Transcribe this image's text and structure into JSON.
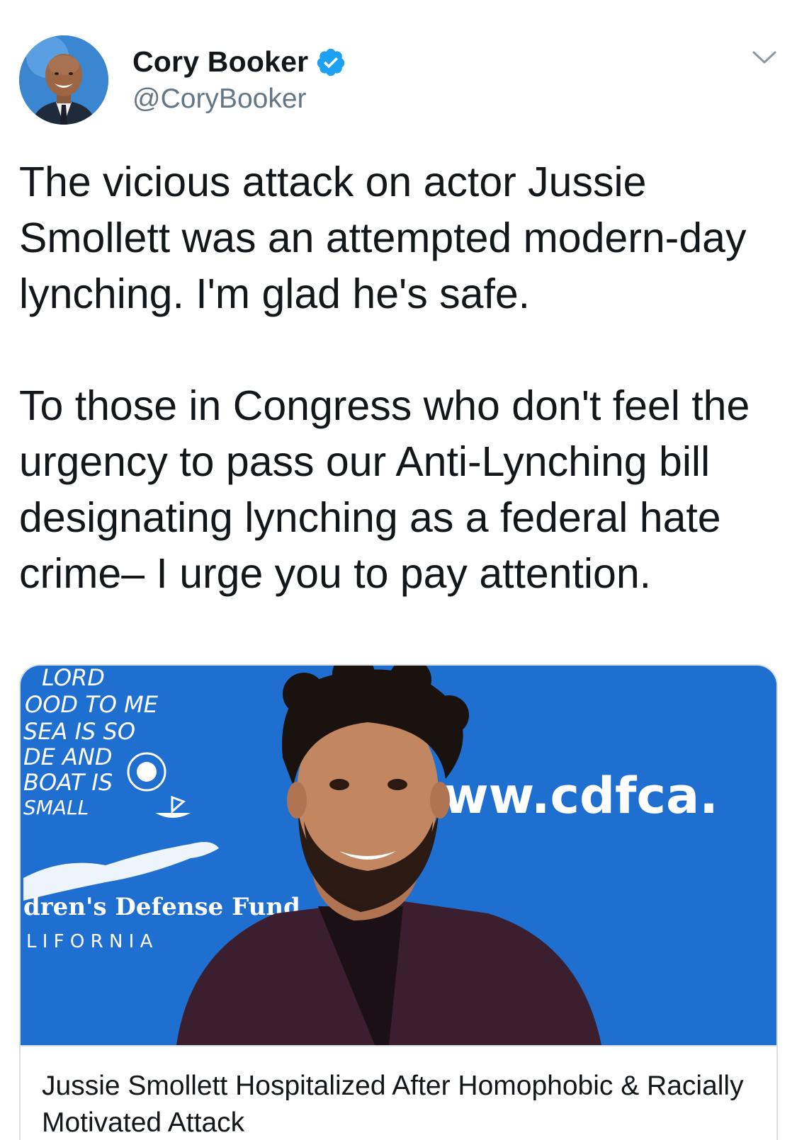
{
  "author": {
    "display_name": "Cory Booker",
    "handle": "@CoryBooker",
    "verified": true,
    "avatar_icon": "profile-photo"
  },
  "menu": {
    "icon": "chevron-down-icon"
  },
  "tweet": {
    "paragraphs": [
      "The vicious attack on actor Jussie Smollett was an attempted modern-day lynching. I'm glad he's safe.",
      "To those in Congress who don't feel the urgency to pass our Anti-Lynching bill designating lynching as a federal hate crime– I urge you to pay attention."
    ]
  },
  "card": {
    "image_backdrop_text": {
      "handwritten": [
        "LORD",
        "OOD TO ME",
        "SEA IS SO",
        "DE AND",
        "BOAT IS",
        "SMALL"
      ],
      "url_fragment": "ww.cdfca.",
      "org_name": "dren's Defense Fund",
      "org_region": "L I F O R N I A"
    },
    "title": "Jussie Smollett Hospitalized After Homophobic & Racially Motivated Attack"
  },
  "colors": {
    "verified_blue": "#1da1f2",
    "backdrop_blue": "#1f6fd1",
    "text_primary": "#14171a",
    "text_secondary": "#657786",
    "border": "#d8e0e6"
  }
}
